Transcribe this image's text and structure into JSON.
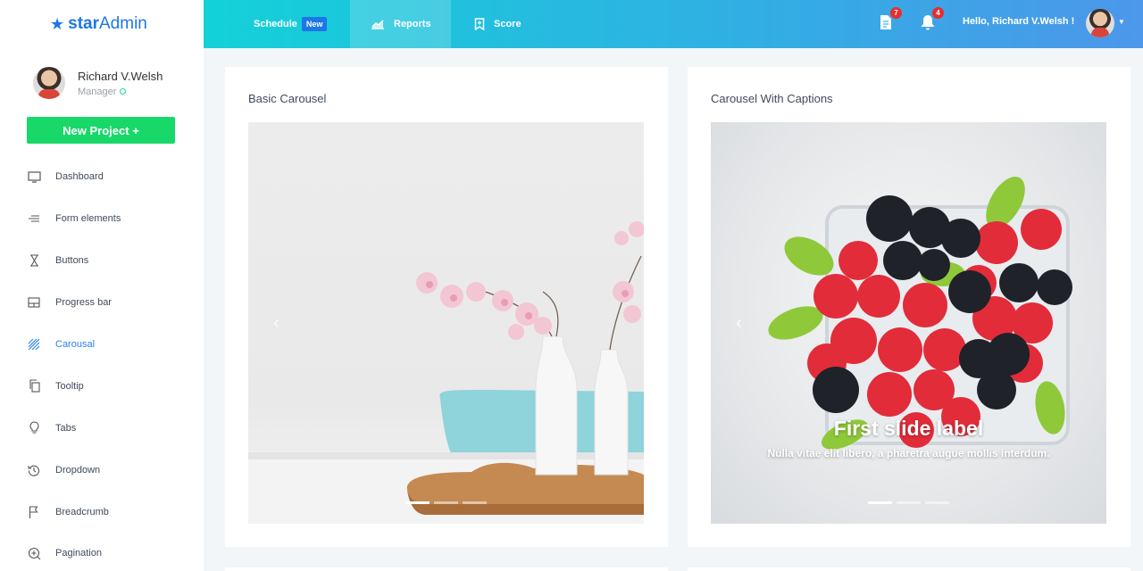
{
  "brand": {
    "prefix": "star",
    "suffix": "Admin"
  },
  "profile": {
    "name": "Richard V.Welsh",
    "role": "Manager"
  },
  "sidebar": {
    "new_project_label": "New Project",
    "items": [
      {
        "label": "Dashboard",
        "icon": "monitor-icon"
      },
      {
        "label": "Form elements",
        "icon": "lines-icon"
      },
      {
        "label": "Buttons",
        "icon": "hourglass-icon"
      },
      {
        "label": "Progress bar",
        "icon": "layout-icon"
      },
      {
        "label": "Carousal",
        "icon": "stripes-icon",
        "active": true
      },
      {
        "label": "Tooltip",
        "icon": "copy-icon"
      },
      {
        "label": "Tabs",
        "icon": "bulb-icon"
      },
      {
        "label": "Dropdown",
        "icon": "history-icon"
      },
      {
        "label": "Breadcrumb",
        "icon": "flag-icon"
      },
      {
        "label": "Pagination",
        "icon": "plus-circle-icon"
      }
    ]
  },
  "topbar": {
    "nav": [
      {
        "label": "Schedule",
        "badge": "New"
      },
      {
        "label": "Reports",
        "icon": "chart-icon"
      },
      {
        "label": "Score",
        "icon": "bookmark-icon"
      }
    ],
    "messages_count": "7",
    "notifications_count": "4",
    "greeting": "Hello, Richard V.Welsh !"
  },
  "cards": {
    "basic": {
      "title": "Basic Carousel"
    },
    "captions": {
      "title": "Carousel With Captions",
      "slide_label": "First slide label",
      "slide_text": "Nulla vitae elit libero, a pharetra augue mollis interdum."
    }
  },
  "colors": {
    "accent": "#1c77e6",
    "success": "#19d86a",
    "badge_red": "#e62e2e"
  }
}
